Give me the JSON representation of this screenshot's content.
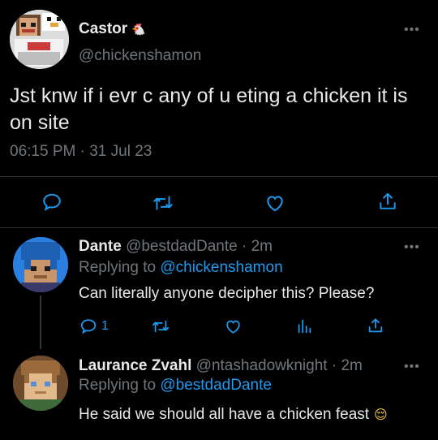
{
  "main_tweet": {
    "display_name": "Castor",
    "name_emoji": "🐔",
    "handle": "@chickenshamon",
    "text": "Jst knw if i evr c any of u eting a chicken it is on site",
    "time": "06:15 PM",
    "separator": "·",
    "date": "31 Jul 23",
    "more": "•••",
    "actions": [
      "reply-icon",
      "retweet-icon",
      "like-icon",
      "share-icon"
    ]
  },
  "replies": [
    {
      "display_name": "Dante",
      "handle": "@bestdadDante",
      "separator": "·",
      "time": "2m",
      "replying_prefix": "Replying to",
      "replying_to": "@chickenshamon",
      "text": "Can literally anyone decipher this? Please?",
      "reply_count": "1",
      "more": "•••"
    },
    {
      "display_name": "Laurance Zvahl",
      "handle": "@ntashadowknight",
      "separator": "·",
      "time": "2m",
      "replying_prefix": "Replying to",
      "replying_to": "@bestdadDante",
      "text": "He said we should all have a chicken feast",
      "text_emoji": "😌",
      "more": "•••"
    }
  ],
  "colors": {
    "background": "#000000",
    "text": "#e7e9ea",
    "muted": "#71767b",
    "accent": "#1d9bf0"
  }
}
